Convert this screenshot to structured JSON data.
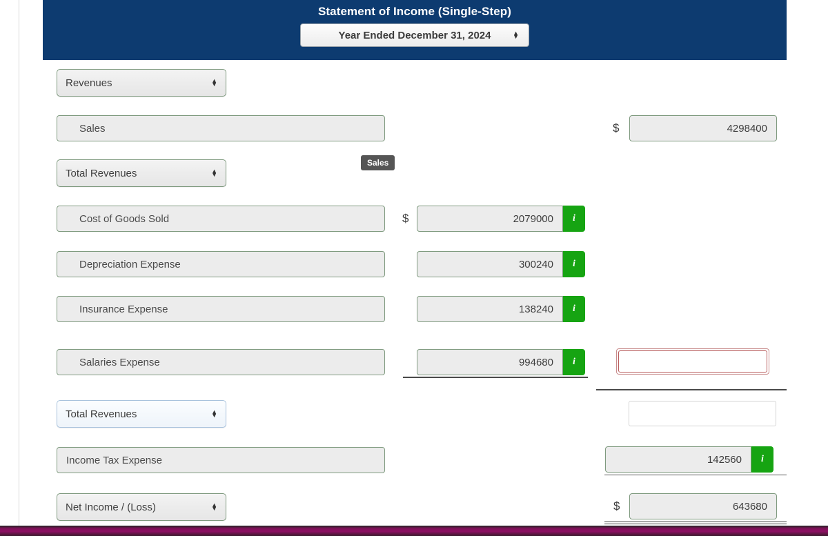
{
  "header": {
    "title": "Statement of Income (Single-Step)",
    "period_value": "Year Ended December 31, 2024",
    "caret_up": "▲",
    "caret_down": "▼",
    "bg_color": "#0d3b70"
  },
  "tooltip": {
    "text": "Sales"
  },
  "icons": {
    "info": "i"
  },
  "symbols": {
    "dollar": "$"
  },
  "colors": {
    "header_blue": "#0d3b70",
    "info_green": "#16a412",
    "field_border_green": "#7f9a7f",
    "error_red": "#b85c5c",
    "selected_blue": "#a8c2dd"
  },
  "rows": [
    {
      "id": "revenues-header",
      "label": "Revenues"
    },
    {
      "id": "sales",
      "label": "Sales",
      "dollar": "$",
      "value": "4298400"
    },
    {
      "id": "total-revenues-1",
      "label": "Total Revenues"
    },
    {
      "id": "cogs",
      "label": "Cost of Goods Sold",
      "dollar": "$",
      "value": "2079000",
      "info": "i"
    },
    {
      "id": "depreciation",
      "label": "Depreciation Expense",
      "value": "300240",
      "info": "i"
    },
    {
      "id": "insurance",
      "label": "Insurance Expense",
      "value": "138240",
      "info": "i"
    },
    {
      "id": "salaries",
      "label": "Salaries Expense",
      "value": "994680",
      "info": "i",
      "error_value": ""
    },
    {
      "id": "total-revenues-2",
      "label": "Total Revenues",
      "empty_value": ""
    },
    {
      "id": "income-tax",
      "label": "Income Tax Expense",
      "value": "142560",
      "info": "i"
    },
    {
      "id": "net-income",
      "label": "Net Income / (Loss)",
      "dollar": "$",
      "value": "643680"
    }
  ]
}
